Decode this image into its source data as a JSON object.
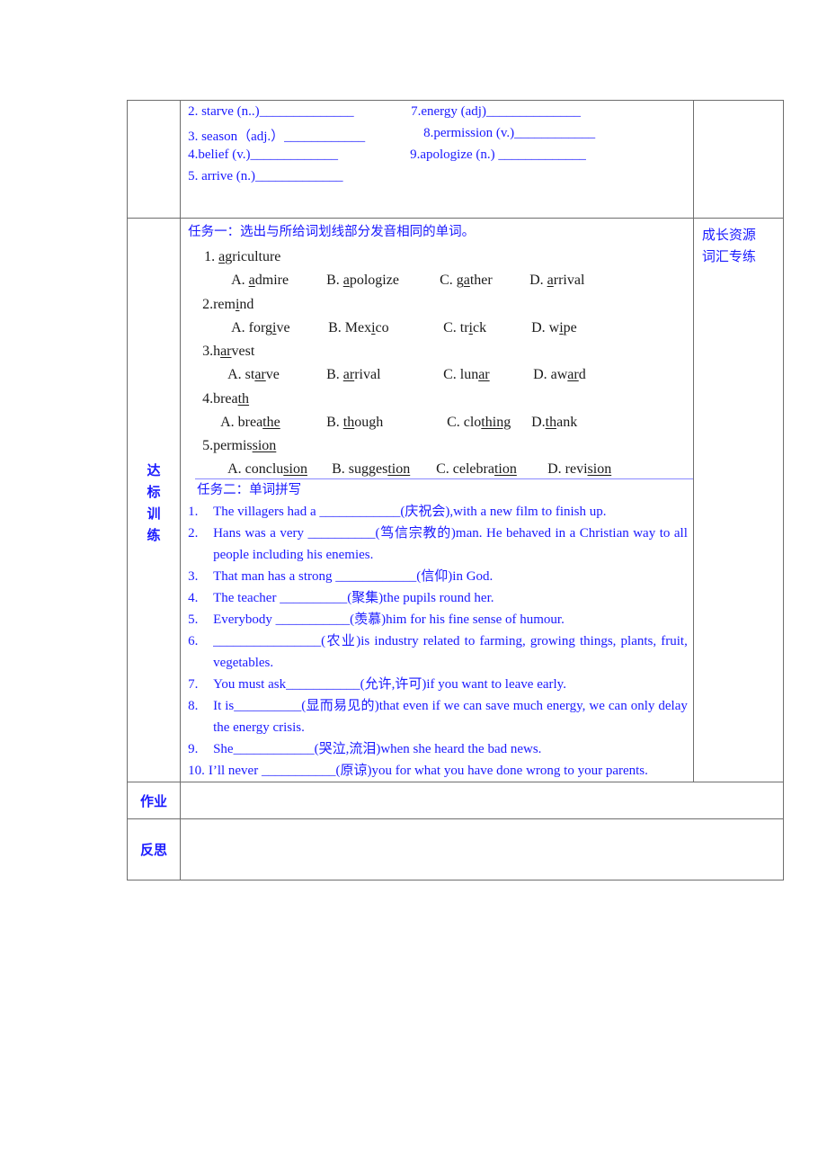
{
  "word_forms": [
    {
      "id": "2",
      "text": "2. starve (n..)______________"
    },
    {
      "id": "7",
      "text": "7.energy (adj)______________"
    },
    {
      "id": "3",
      "text": "3. season（adj.）____________"
    },
    {
      "id": "8",
      "text": "8.permission (v.)____________"
    },
    {
      "id": "4",
      "text": "4.belief (v.)_____________"
    },
    {
      "id": "9",
      "text": "9.apologize (n.) _____________"
    },
    {
      "id": "5",
      "text": "5. arrive (n.)_____________"
    }
  ],
  "section_label": [
    "达",
    "标",
    "训",
    "练"
  ],
  "resource_label": [
    "成长资源",
    "词汇专练"
  ],
  "task1": {
    "title": "任务一：选出与所给词划线部分发音相同的单词。",
    "questions": [
      {
        "stem": {
          "prefix": "1. ",
          "pre": "",
          "u": "a",
          "post": "griculture"
        },
        "options": [
          {
            "label": "A. ",
            "pre": "",
            "u": "a",
            "post": "dmire"
          },
          {
            "label": "B. ",
            "pre": "",
            "u": "a",
            "post": "pologize"
          },
          {
            "label": "C. ",
            "pre": "g",
            "u": "a",
            "post": "ther"
          },
          {
            "label": "D. ",
            "pre": "",
            "u": "a",
            "post": "rrival"
          }
        ]
      },
      {
        "stem": {
          "prefix": "2.",
          "pre": "rem",
          "u": "i",
          "post": "nd"
        },
        "options": [
          {
            "label": "A. ",
            "pre": "forg",
            "u": "i",
            "post": "ve"
          },
          {
            "label": "B. ",
            "pre": "Mex",
            "u": "i",
            "post": "co"
          },
          {
            "label": "C. ",
            "pre": "tr",
            "u": "i",
            "post": "ck"
          },
          {
            "label": "D. ",
            "pre": "w",
            "u": "i",
            "post": "pe"
          }
        ]
      },
      {
        "stem": {
          "prefix": "3.",
          "pre": "h",
          "u": "ar",
          "post": "vest"
        },
        "options": [
          {
            "label": "A. ",
            "pre": "st",
            "u": "ar",
            "post": "ve"
          },
          {
            "label": "B. ",
            "pre": "",
            "u": "ar",
            "post": "rival"
          },
          {
            "label": "C. ",
            "pre": "lun",
            "u": "ar",
            "post": ""
          },
          {
            "label": "D. ",
            "pre": "aw",
            "u": "ar",
            "post": "d"
          }
        ]
      },
      {
        "stem": {
          "prefix": "4.",
          "pre": "brea",
          "u": "th",
          "post": ""
        },
        "options": [
          {
            "label": "A. ",
            "pre": "brea",
            "u": "the",
            "post": ""
          },
          {
            "label": "B. ",
            "pre": "",
            "u": "th",
            "post": "ough"
          },
          {
            "label": "C. ",
            "pre": "clo",
            "u": "thing",
            "post": ""
          },
          {
            "label": "D.",
            "pre": "",
            "u": "th",
            "post": "ank"
          }
        ]
      },
      {
        "stem": {
          "prefix": "5.",
          "pre": "permis",
          "u": "sion",
          "post": ""
        },
        "options": [
          {
            "label": "A. ",
            "pre": "conclu",
            "u": "sion",
            "post": ""
          },
          {
            "label": "B. ",
            "pre": "sugges",
            "u": "tion",
            "post": ""
          },
          {
            "label": "C. ",
            "pre": "celebra",
            "u": "tion",
            "post": ""
          },
          {
            "label": "D. ",
            "pre": "revi",
            "u": "sion",
            "post": ""
          }
        ]
      }
    ]
  },
  "task2": {
    "title": "任务二：单词拼写",
    "sentences": [
      {
        "num": "1.",
        "text": "The villagers had a ____________(庆祝会),with a new film to finish up."
      },
      {
        "num": "2.",
        "text": "Hans was a very __________(笃信宗教的)man. He behaved in a Christian way to all people including his enemies."
      },
      {
        "num": "3.",
        "text": "That man has a strong ____________(信仰)in God."
      },
      {
        "num": "4.",
        "text": "The teacher __________(聚集)the pupils round her."
      },
      {
        "num": "5.",
        "text": "Everybody ___________(羡慕)him for his fine sense of humour."
      },
      {
        "num": "6.",
        "text": "________________(农业)is industry related to farming, growing things, plants, fruit, vegetables."
      },
      {
        "num": "7.",
        "text": "You must ask___________(允许,许可)if you want to leave early."
      },
      {
        "num": "8.",
        "text": "It is__________(显而易见的)that even if we can save much energy, we can only delay the energy crisis."
      },
      {
        "num": "9.",
        "text": "She____________(哭泣,流泪)when she heard the bad news."
      },
      {
        "num": "10.",
        "text": "I’ll never ___________(原谅)you for what you have done wrong to your parents."
      }
    ]
  },
  "homework_label": "作业",
  "reflection_label": "反思",
  "colors": {
    "text_blue": "#1a1aff",
    "border": "#6e6e6e",
    "divider": "#8a8aff"
  }
}
